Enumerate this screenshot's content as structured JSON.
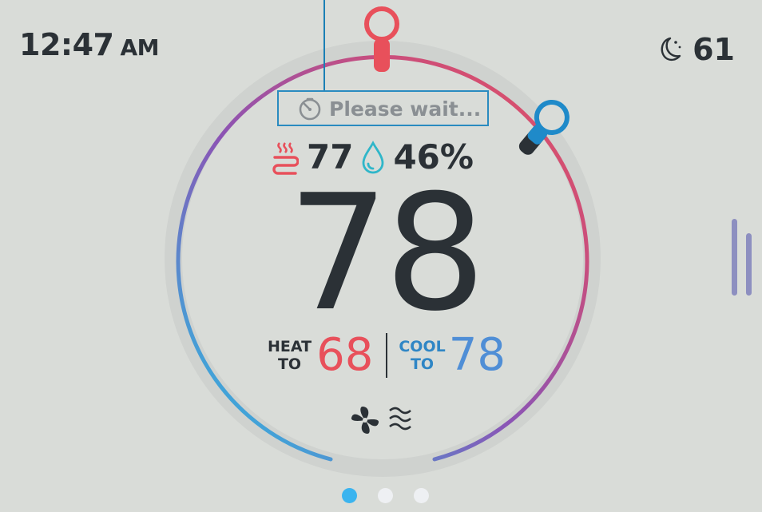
{
  "clock": {
    "time": "12:47",
    "ampm": "AM"
  },
  "outdoor": {
    "temperature": "61",
    "icon": "moon-icon"
  },
  "status": {
    "text": "Please wait...",
    "icon": "timer-icon"
  },
  "indoor": {
    "heat_icon": "heat-waves-icon",
    "temperature": "77",
    "humidity_icon": "water-drop-icon",
    "humidity": "46%"
  },
  "current": {
    "temperature": "78"
  },
  "setpoints": {
    "heat_label_top": "HEAT",
    "heat_label_bottom": "TO",
    "heat_value": "68",
    "cool_label_top": "COOL",
    "cool_label_bottom": "TO",
    "cool_value": "78"
  },
  "fan": {
    "icon": "fan-icon",
    "mode_icon": "airflow-icon"
  },
  "pager": {
    "pages": 3,
    "active": 1
  },
  "colors": {
    "heat": "#e8505b",
    "cool": "#4f8ed6",
    "text": "#2b3136",
    "ring_gradient": [
      "#21c6e8",
      "#8b54b5",
      "#e8505b"
    ],
    "background": "#d9dcd8"
  }
}
